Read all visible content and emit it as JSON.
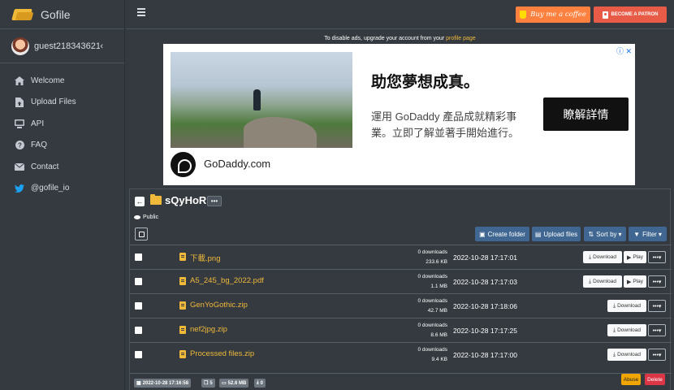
{
  "app": {
    "name": "Gofile"
  },
  "user": {
    "name": "guest218343621...",
    "toggle": "‹"
  },
  "sidebar": {
    "items": [
      {
        "label": "Welcome",
        "icon": "home-icon"
      },
      {
        "label": "Upload Files",
        "icon": "file-upload-icon"
      },
      {
        "label": "API",
        "icon": "api-icon"
      },
      {
        "label": "FAQ",
        "icon": "question-icon"
      },
      {
        "label": "Contact",
        "icon": "envelope-icon"
      },
      {
        "label": "@gofile_io",
        "icon": "twitter-icon"
      }
    ]
  },
  "header": {
    "coffee_label": "Buy me a coffee",
    "patron_label": "BECOME A PATRON"
  },
  "ads": {
    "note_prefix": "To disable ads, upgrade your account from your ",
    "note_link": "profile page",
    "title": "助您夢想成真。",
    "body": "運用 GoDaddy 產品成就精彩事業。立即了解並著手開始進行。",
    "cta": "瞭解詳情",
    "brand": "GoDaddy.com"
  },
  "folder": {
    "name": "sQyHoR",
    "visibility": "Public",
    "toolbar": {
      "create_folder": "Create folder",
      "upload_files": "Upload files",
      "sort_by": "Sort by",
      "filter": "Filter"
    },
    "files": [
      {
        "name": "下載.png",
        "downloads": "0 downloads",
        "size": "233.6 KB",
        "date": "2022-10-28 17:17:01",
        "playable": true
      },
      {
        "name": "A5_245_bg_2022.pdf",
        "downloads": "0 downloads",
        "size": "1.1 MB",
        "date": "2022-10-28 17:17:03",
        "playable": true
      },
      {
        "name": "GenYoGothic.zip",
        "downloads": "0 downloads",
        "size": "42.7 MB",
        "date": "2022-10-28 17:18:06",
        "playable": false
      },
      {
        "name": "nef2jpg.zip",
        "downloads": "0 downloads",
        "size": "8.6 MB",
        "date": "2022-10-28 17:17:25",
        "playable": false
      },
      {
        "name": "Processed files.zip",
        "downloads": "0 downloads",
        "size": "9.4 KB",
        "date": "2022-10-28 17:17:00",
        "playable": false
      }
    ],
    "download_label": "Download",
    "play_label": "Play",
    "footer": {
      "created": "2022-10-28 17:16:58",
      "file_count": "5",
      "total_size": "52.6 MB",
      "downloads": "0",
      "abuse_label": "Abuse",
      "delete_label": "Delete"
    }
  },
  "colors": {
    "background": "#343a40",
    "accent": "#f0b93a",
    "toolbar_button": "#3f6791",
    "coffee": "#ff813f",
    "patron": "#e85b46",
    "abuse": "#f0a500",
    "delete": "#dc3545"
  }
}
